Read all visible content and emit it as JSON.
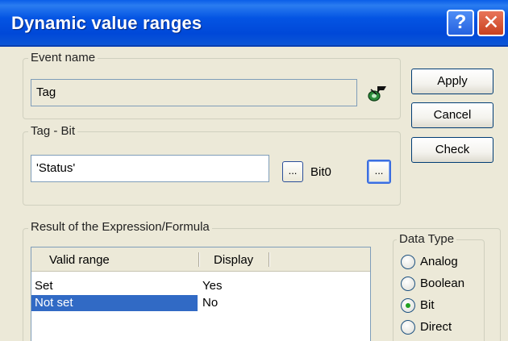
{
  "window": {
    "title": "Dynamic value ranges",
    "help_glyph": "?",
    "close_glyph": "✕"
  },
  "event_group": {
    "label": "Event name",
    "value": "Tag"
  },
  "tag_group": {
    "label": "Tag - Bit",
    "value": "'Status'",
    "browse_label": "...",
    "bit_label": "Bit0",
    "bit_browse_label": "..."
  },
  "buttons": {
    "apply": "Apply",
    "cancel": "Cancel",
    "check": "Check"
  },
  "result_group": {
    "label": "Result of the Expression/Formula",
    "columns": [
      "Valid range",
      "Display"
    ],
    "rows": [
      {
        "range": "Set",
        "display": "Yes",
        "selected": false
      },
      {
        "range": "Not set",
        "display": "No",
        "selected": true
      }
    ]
  },
  "data_type": {
    "label": "Data Type",
    "options": [
      "Analog",
      "Boolean",
      "Bit",
      "Direct"
    ],
    "selected": "Bit"
  },
  "icons": {
    "tag_icon": "tag-select-icon"
  }
}
